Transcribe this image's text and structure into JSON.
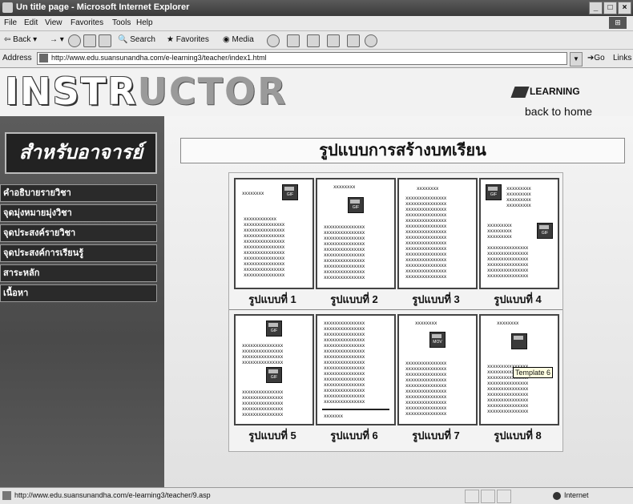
{
  "window": {
    "title": "Un title page - Microsoft Internet Explorer",
    "controls": [
      "_",
      "□",
      "×"
    ]
  },
  "menu": [
    "File",
    "Edit",
    "View",
    "Favorites",
    "Tools",
    "Help"
  ],
  "toolbar": {
    "back": "Back",
    "search": "Search",
    "favorites": "Favorites",
    "media": "Media"
  },
  "address": {
    "label": "Address",
    "url": "http://www.edu.suansunandha.com/e-learning3/teacher/index1.html",
    "go": "Go",
    "links": "Links"
  },
  "banner": {
    "title_part1": "INSTR",
    "title_part2": "UCTOR",
    "logo_text": "LEARNING",
    "back_link": "back to home"
  },
  "sidebar": {
    "header": "สำหรับอาจารย์",
    "items": [
      "คำอธิบายรายวิชา",
      "จุดมุ่งหมายมุ่งวิชา",
      "จุดประสงค์รายวิชา",
      "จุดประสงค์การเรียนรู้",
      "สาระหลัก",
      "เนื้อหา"
    ]
  },
  "main": {
    "heading": "รูปแบบการสร้างบทเรียน",
    "captions": [
      "รูปแบบที่ 1",
      "รูปแบบที่ 2",
      "รูปแบบที่ 3",
      "รูปแบบที่ 4",
      "รูปแบบที่ 5",
      "รูปแบบที่ 6",
      "รูปแบบที่ 7",
      "รูปแบบที่ 8"
    ],
    "icon_labels": {
      "gif": "GIF",
      "mov": "MOV"
    },
    "tpl_title": "xxxxxxxx",
    "tooltip": "Template 6"
  },
  "status": {
    "url": "http://www.edu.suansunandha.com/e-learning3/teacher/9.asp",
    "zone": "Internet"
  }
}
